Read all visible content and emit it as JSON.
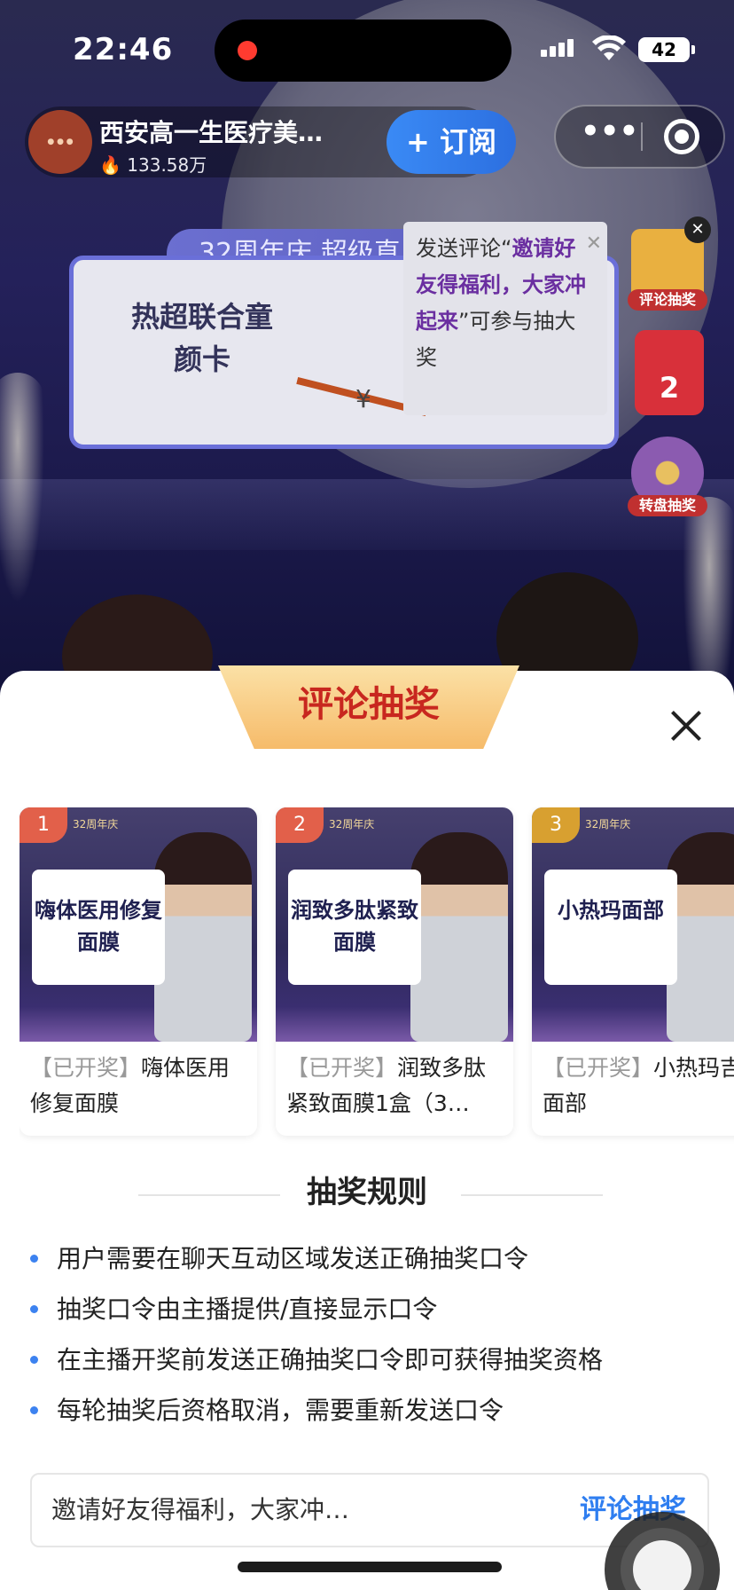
{
  "status_bar": {
    "time": "22:46",
    "battery": "42"
  },
  "header": {
    "anchor_name": "西安高一生医疗美…",
    "popularity": "133.58万",
    "subscribe_label": "+ 订阅",
    "more_icon": "more-icon",
    "target_icon": "close-miniapp-icon"
  },
  "promo": {
    "tab_text": "32周年庆  超级直",
    "card_text": "热超联合童颜卡",
    "yen": "¥"
  },
  "tip": {
    "prefix": "发送评论“",
    "highlight": "邀请好友得福利，大家冲起来",
    "suffix": "”可参与抽大奖"
  },
  "widgets": {
    "comment_label": "评论抽奖",
    "gift_count": "2",
    "wheel_label": "转盘抽奖"
  },
  "sheet": {
    "title": "评论抽奖",
    "prizes": [
      {
        "rank": "1",
        "tag": "32周年庆",
        "box": "嗨体医用修复面膜",
        "status": "【已开奖】",
        "name": "嗨体医用修复面膜"
      },
      {
        "rank": "2",
        "tag": "32周年庆",
        "box": "润致多肽紧致面膜",
        "status": "【已开奖】",
        "name": "润致多肽紧致面膜1盒（3…"
      },
      {
        "rank": "3",
        "tag": "32周年庆",
        "box": "小热玛面部",
        "status": "【已开奖】",
        "name": "小热玛吉面部"
      }
    ],
    "rules_title": "抽奖规则",
    "rules": [
      "用户需要在聊天互动区域发送正确抽奖口令",
      "抽奖口令由主播提供/直接显示口令",
      "在主播开奖前发送正确抽奖口令即可获得抽奖资格",
      "每轮抽奖后资格取消，需要重新发送口令"
    ],
    "input_text": "邀请好友得福利，大家冲…",
    "submit_label": "评论抽奖"
  }
}
